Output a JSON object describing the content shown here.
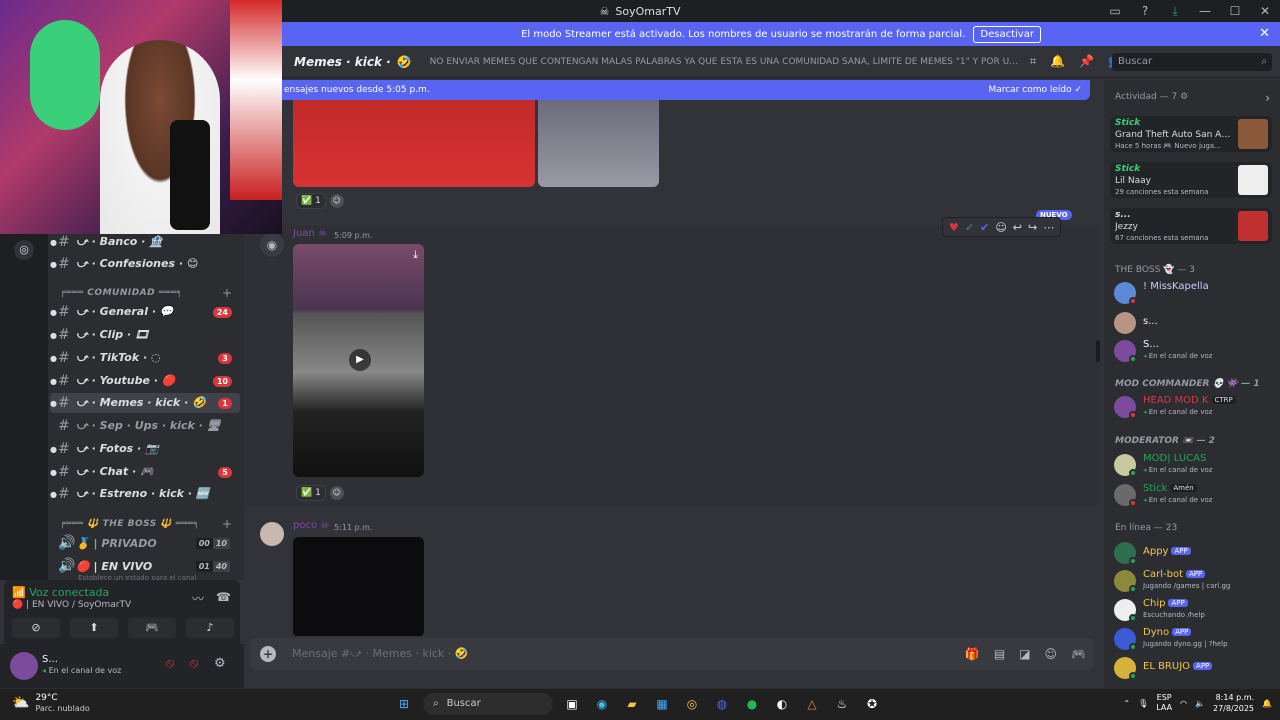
{
  "window": {
    "title": "SoyOmarTV"
  },
  "banner": {
    "text": "El modo Streamer está activado. Los nombres de usuario se mostrarán de forma parcial.",
    "button": "Desactivar"
  },
  "channel_header": {
    "name": "Memes · kick ·",
    "topic": "NO ENVIAR MEMES QUE CONTENGAN MALAS PALABRAS YA QUE ESTA ES UNA COMUNIDAD SANA, LIMITE DE MEMES \"1\" Y POR ULTIMO EL ...",
    "search_placeholder": "Buscar"
  },
  "new_messages_bar": {
    "text": "ensajes nuevos desde 5:05 p.m.",
    "action": "Marcar como leído"
  },
  "sidebar": {
    "channels": [
      {
        "label": "⤻ · Banco · 🏦",
        "badge": ""
      },
      {
        "label": "⤻ · Confesiones · 😊",
        "badge": ""
      },
      {
        "label": "⤻ · General · 💬",
        "badge": "24"
      },
      {
        "label": "⤻ · Clip · 🎞",
        "badge": ""
      },
      {
        "label": "⤻ · TikTok · ◌",
        "badge": "3"
      },
      {
        "label": "⤻ · Youtube · 🔴",
        "badge": "10"
      },
      {
        "label": "⤻ · Memes · kick · 🤣",
        "badge": "1"
      },
      {
        "label": "⤻ · Sep · Ups · kick · 🖥",
        "badge": ""
      },
      {
        "label": "⤻ · Fotos · 📷",
        "badge": ""
      },
      {
        "label": "⤻ · Chat · 🎮",
        "badge": "5"
      },
      {
        "label": "⤻ · Estreno · kick · 🆕",
        "badge": ""
      }
    ],
    "category_comunidad": "╒═══ COMUNIDAD ═══╕",
    "category_boss": "╒═══ 🔱 THE BOSS 🔱 ═══╕",
    "voice_channels": [
      {
        "label": "🥇 | PRIVADO",
        "count": "00",
        "limit": "10"
      },
      {
        "label": "🔴 | EN VIVO",
        "count": "01",
        "limit": "40"
      }
    ],
    "voice_status_hint": "Establece un estado para el canal"
  },
  "voice_panel": {
    "title": "Voz conectada",
    "subtitle": "🔴 | EN VIVO / SoyOmarTV"
  },
  "user_panel": {
    "name": "S...",
    "status": "En el canal de voz"
  },
  "messages": [
    {
      "reaction_count": "1"
    },
    {
      "author": "Juan",
      "time": "5:09 p.m.",
      "reaction_count": "1",
      "badge": "NUEVO"
    },
    {
      "author": "poco",
      "time": "5:11 p.m."
    }
  ],
  "composer": {
    "placeholder": "Mensaje #⤻ · Memes · kick · 🤣"
  },
  "members": {
    "activity_header": "Actividad — 7",
    "activities": [
      {
        "name": "Stick",
        "title": "Grand Theft Auto San Andr...",
        "sub": "Hace 5 horas  🎮 Nuevo juga..."
      },
      {
        "name": "Stick",
        "title": "Lil Naay",
        "sub": "29 canciones esta semana"
      },
      {
        "name": "s...",
        "title": "Jezzy",
        "sub": "67 canciones esta semana"
      }
    ],
    "boss_header": "THE BOSS 👻 — 3",
    "boss": [
      {
        "name": "! MissKapella",
        "status": ""
      },
      {
        "name": "s...",
        "status": ""
      },
      {
        "name": "S...",
        "status": "En el canal de voz"
      }
    ],
    "modcmd_header": "MOD COMMANDER 💀 👾 — 1",
    "modcmd": [
      {
        "name": "HEAD MOD K",
        "tag": "CTRP",
        "status": "En el canal de voz"
      }
    ],
    "moderator_header": "MODERATOR 📼 — 2",
    "moderators": [
      {
        "name": "MOD| LUCAS",
        "tag": "",
        "status": "En el canal de voz"
      },
      {
        "name": "Stick",
        "tag": "Amén",
        "status": "En el canal de voz"
      }
    ],
    "online_header": "En línea — 23",
    "online": [
      {
        "name": "Appy",
        "app": "APP",
        "status": ""
      },
      {
        "name": "Carl-bot",
        "app": "APP",
        "status": "Jugando /games | carl.gg"
      },
      {
        "name": "Chip",
        "app": "APP",
        "status": "Escuchando /help"
      },
      {
        "name": "Dyno",
        "app": "APP",
        "status": "Jugando dyno.gg | ?help"
      },
      {
        "name": "EL BRUJO",
        "app": "APP",
        "status": ""
      }
    ]
  },
  "taskbar": {
    "temp": "29°C",
    "weather": "Parc. nublado",
    "search": "Buscar",
    "lang": "ESP",
    "lang2": "LAA",
    "time": "8:14 p.m.",
    "date": "27/8/2025"
  },
  "colors": {
    "accent": "#5865f2",
    "online": "#23a55a",
    "danger": "#da373c"
  }
}
